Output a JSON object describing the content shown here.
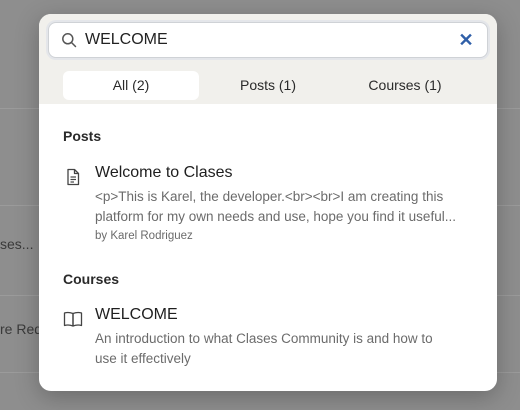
{
  "background": {
    "snippets": [
      "ses...",
      "re Req"
    ]
  },
  "search": {
    "value": "WELCOME",
    "clear_icon": "close-icon",
    "clear_glyph": "✕"
  },
  "tabs": [
    {
      "label": "All (2)",
      "active": true
    },
    {
      "label": "Posts (1)",
      "active": false
    },
    {
      "label": "Courses (1)",
      "active": false
    }
  ],
  "sections": {
    "posts": {
      "title": "Posts",
      "item": {
        "icon": "document-icon",
        "title": "Welcome to Clases",
        "body_line1": "<p>This is Karel, the developer.<br><br>I am creating this",
        "body_line2": "platform for my own needs and use, hope you find it useful...",
        "author": "by Karel Rodriguez"
      }
    },
    "courses": {
      "title": "Courses",
      "item": {
        "icon": "book-icon",
        "title": "WELCOME",
        "body_line1": "An introduction to what Clases Community is and how to",
        "body_line2": "use it effectively"
      }
    }
  },
  "colors": {
    "overlay": "#8e8e8e",
    "modal": "#ffffff",
    "tab_bar": "#f1f0ec",
    "clear_icon": "#2f5fa8"
  }
}
